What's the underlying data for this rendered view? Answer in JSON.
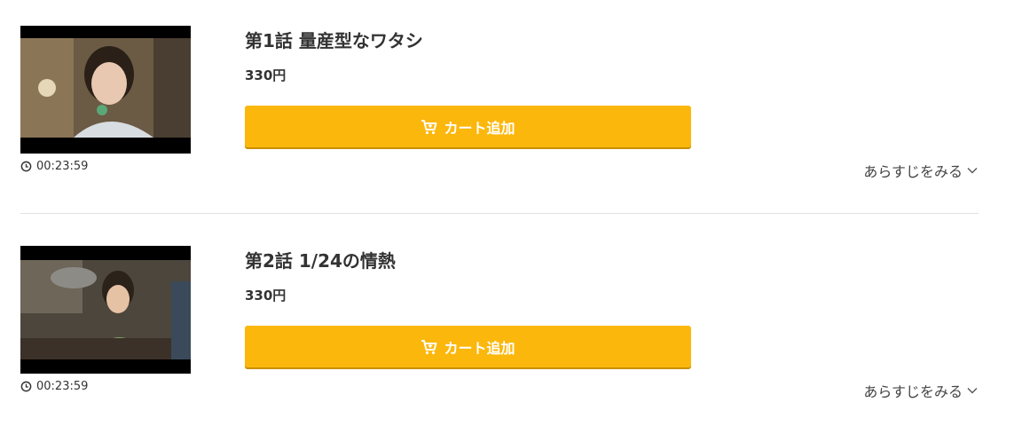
{
  "episodes": [
    {
      "title": "第1話 量産型なワタシ",
      "price": "330円",
      "duration": "00:23:59",
      "cart_label": "カート追加",
      "synopsis_label": "あらすじをみる"
    },
    {
      "title": "第2話 1/24の情熱",
      "price": "330円",
      "duration": "00:23:59",
      "cart_label": "カート追加",
      "synopsis_label": "あらすじをみる"
    }
  ],
  "icons": {
    "clock": "clock-icon",
    "cart": "cart-icon",
    "chevron": "chevron-down-icon"
  },
  "colors": {
    "cart_button": "#fcb70c",
    "divider": "#e0e0e0"
  }
}
